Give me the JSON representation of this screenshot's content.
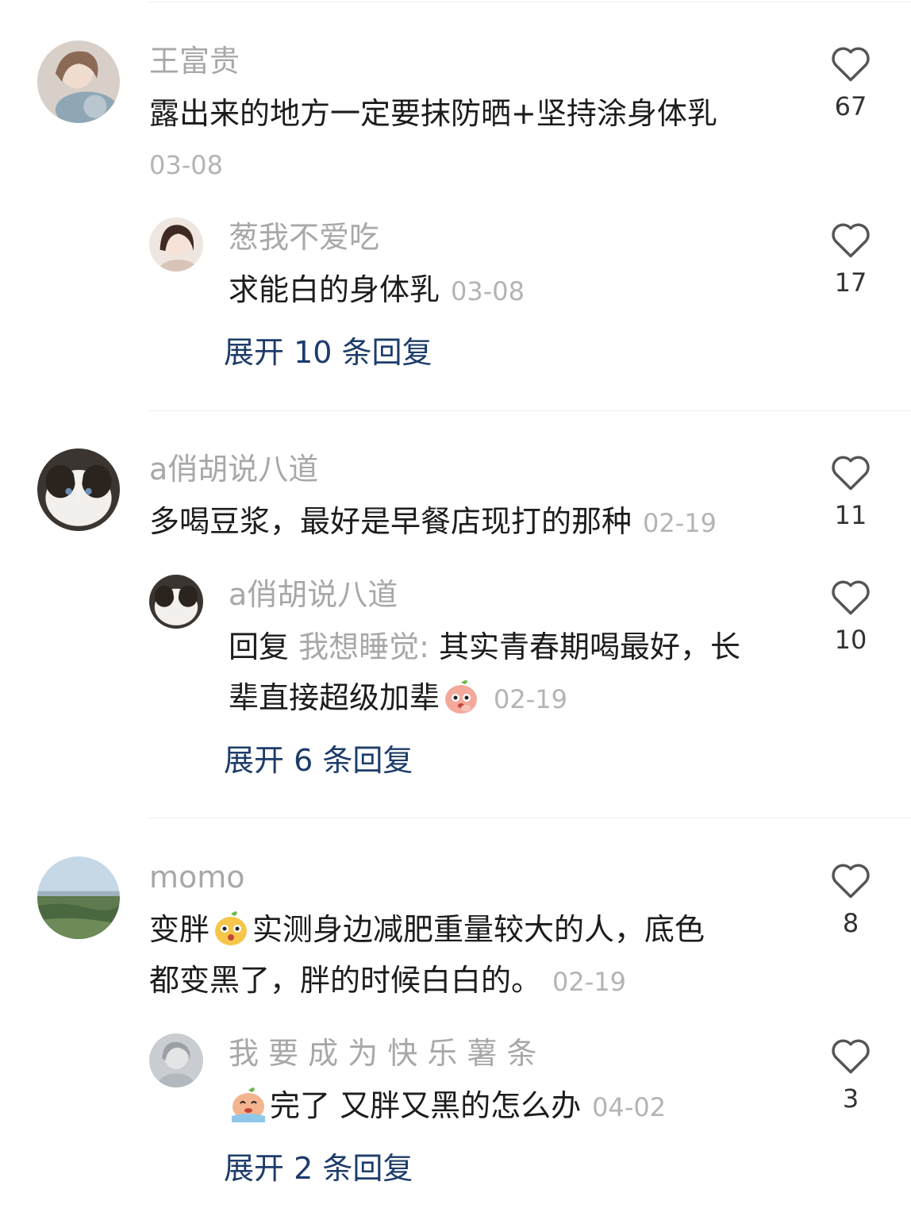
{
  "comments": [
    {
      "user": "王富贵",
      "text": "露出来的地方一定要抹防晒+坚持涂身体乳",
      "date": "03-08",
      "likes": "67",
      "reply": {
        "user": "葱我不爱吃",
        "text": "求能白的身体乳",
        "date": "03-08",
        "likes": "17"
      },
      "expand": "展开 10 条回复"
    },
    {
      "user": "a俏胡说八道",
      "text": "多喝豆浆，最好是早餐店现打的那种",
      "date": "02-19",
      "likes": "11",
      "reply": {
        "user": "a俏胡说八道",
        "prefix": "回复",
        "reply_to": "我想睡觉:",
        "text_line1": "其实青春期喝最好，长",
        "text_line2": "辈直接超级加辈",
        "emoji": "shy-emoji",
        "date": "02-19",
        "likes": "10"
      },
      "expand": "展开 6 条回复"
    },
    {
      "user": "momo",
      "text_a": "变胖",
      "emoji": "surprised-emoji",
      "text_b": "实测身边减肥重量较大的人，底色",
      "text_line2": "都变黑了，胖的时候白白的。",
      "date": "02-19",
      "likes": "8",
      "reply": {
        "user": "我 要 成 为 快 乐 薯 条",
        "emoji": "crying-emoji",
        "text": "完了 又胖又黑的怎么办",
        "date": "04-02",
        "likes": "3"
      },
      "expand": "展开 2 条回复"
    }
  ],
  "colors": {
    "link": "#1d3c6a",
    "username": "#a8a8a8",
    "text": "#1c1c1c",
    "meta": "#b4b4b4"
  }
}
